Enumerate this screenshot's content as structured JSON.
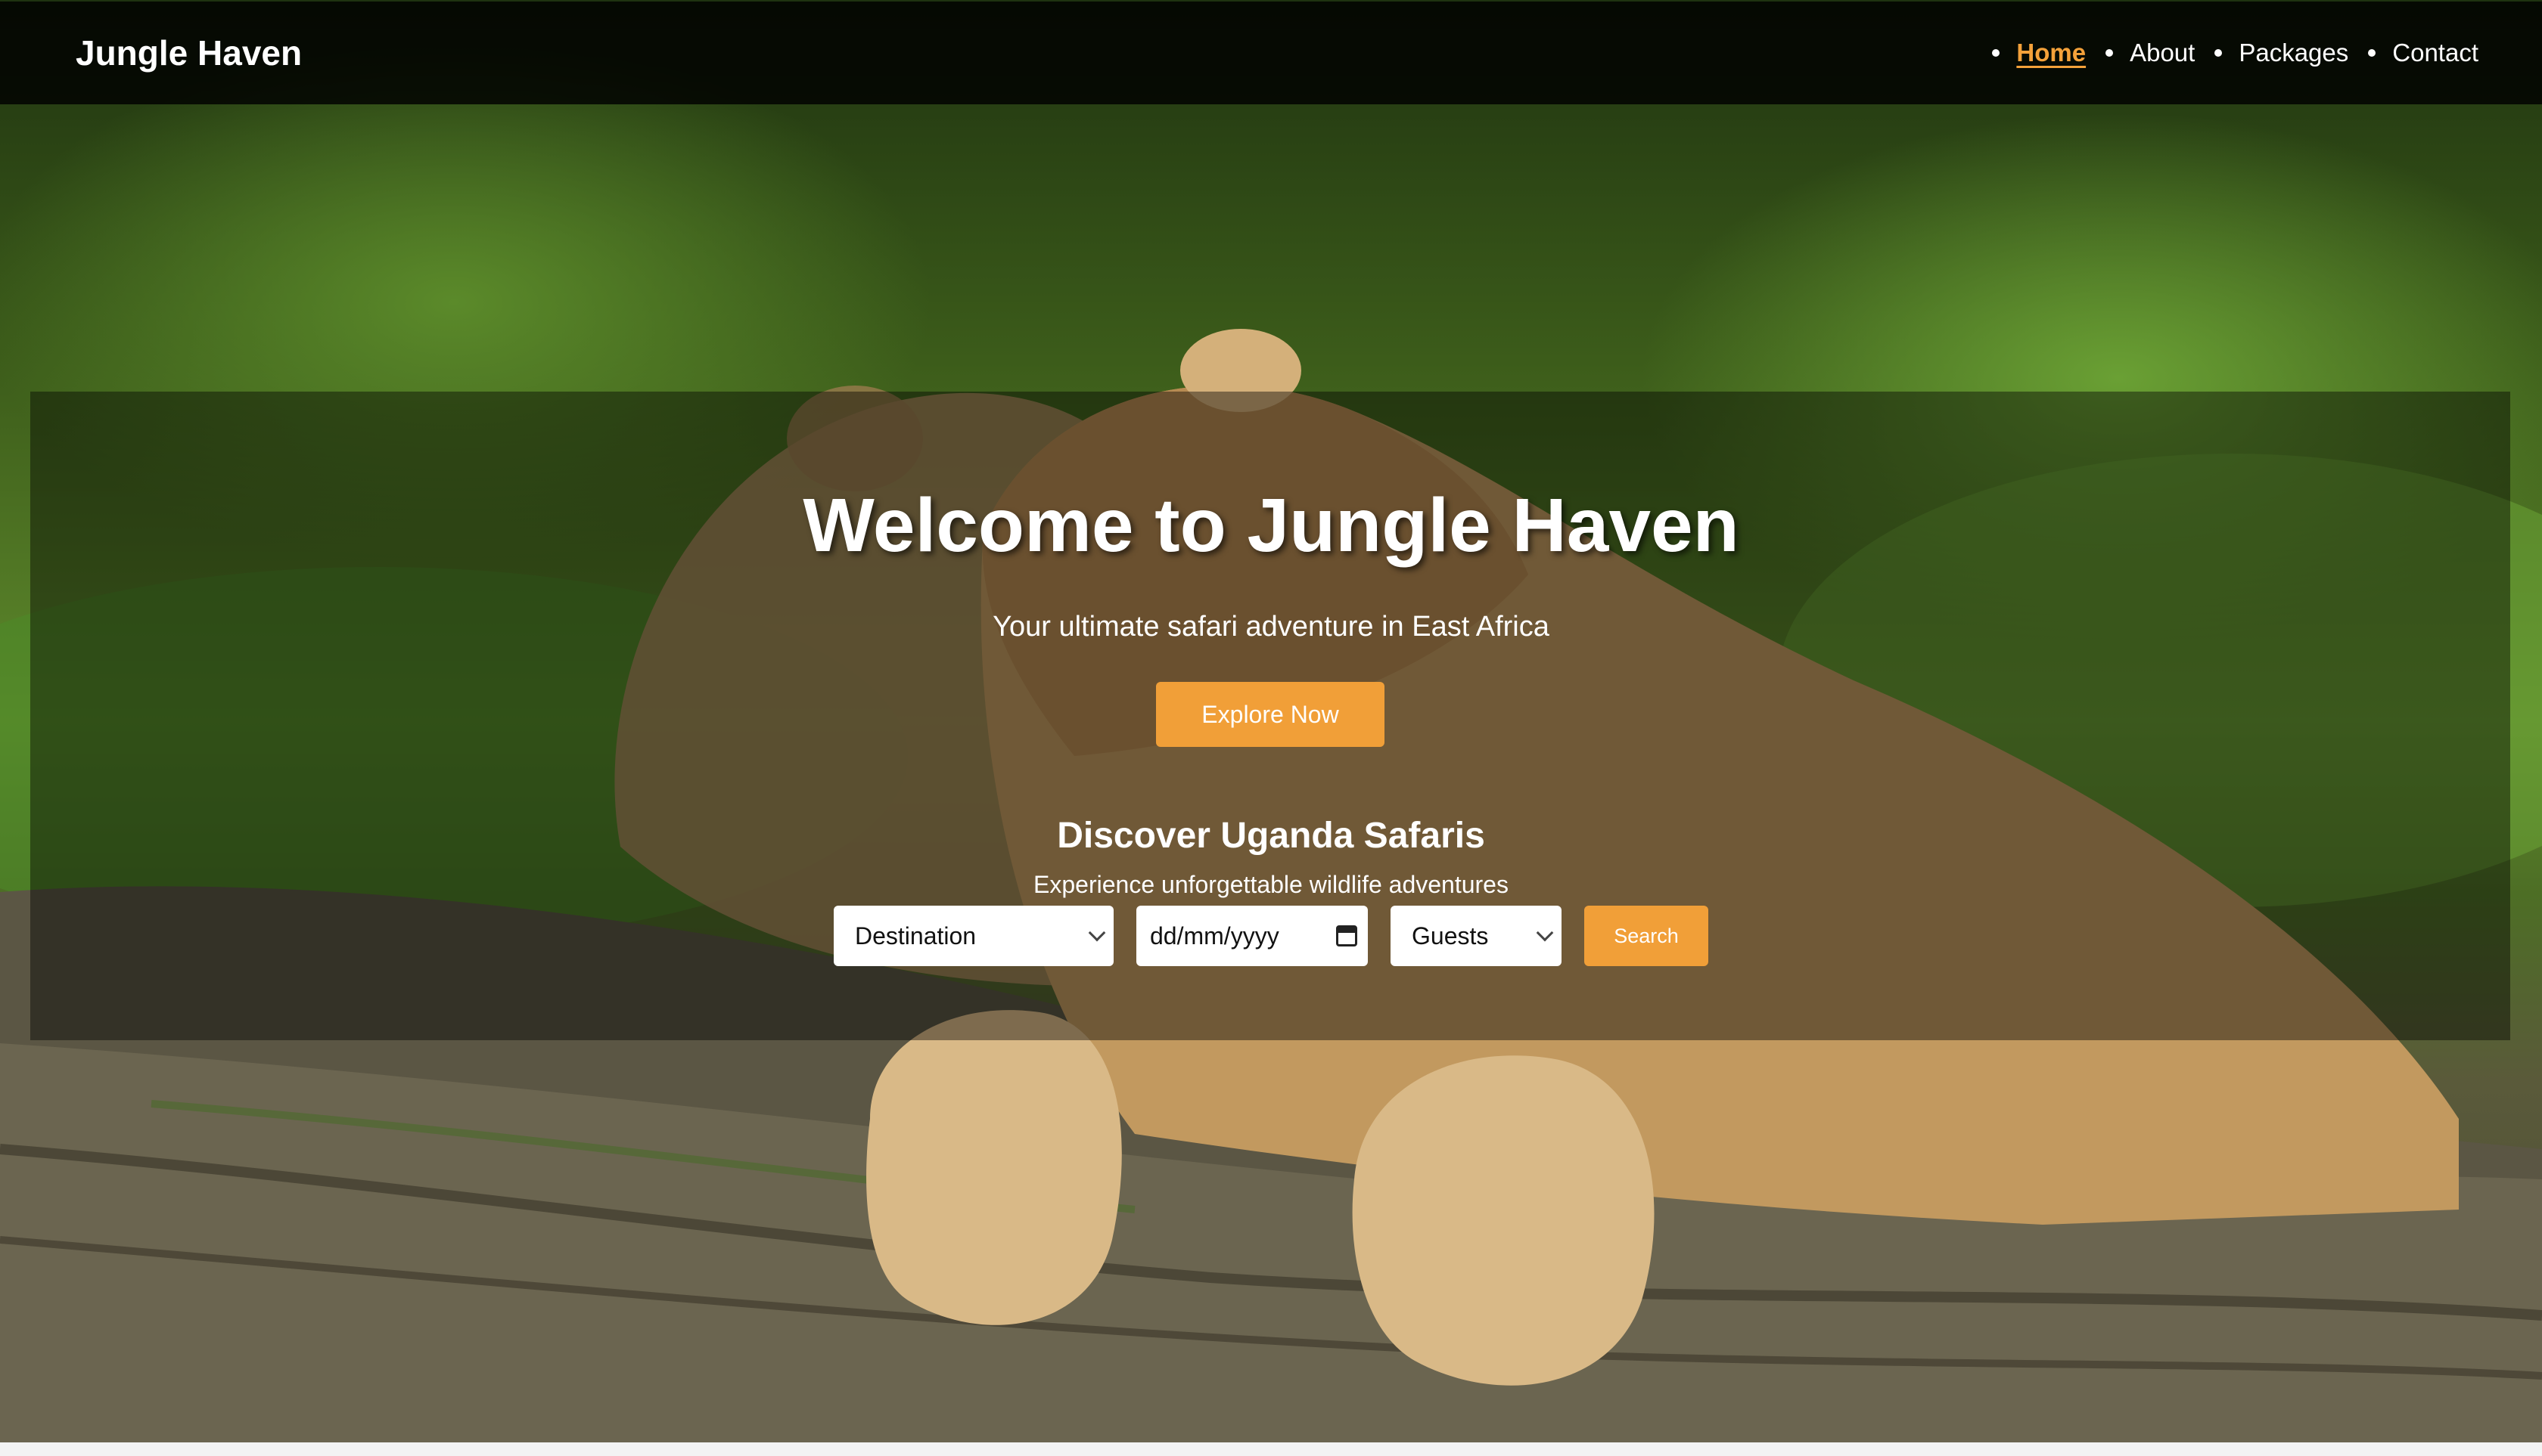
{
  "navbar": {
    "brand": "Jungle Haven",
    "links": [
      {
        "label": "Home",
        "active": true
      },
      {
        "label": "About",
        "active": false
      },
      {
        "label": "Packages",
        "active": false
      },
      {
        "label": "Contact",
        "active": false
      }
    ]
  },
  "hero": {
    "title": "Welcome to Jungle Haven",
    "subtitle": "Your ultimate safari adventure in East Africa",
    "cta_label": "Explore Now",
    "background": "lion-cubs-photo"
  },
  "search": {
    "title": "Discover Uganda Safaris",
    "subtitle": "Experience unforgettable wildlife adventures",
    "destination_value": "Destination",
    "date_placeholder": "dd/mm/yyyy",
    "guests_value": "Guests",
    "button_label": "Search"
  },
  "colors": {
    "accent": "#f19f38",
    "active_link": "#f4a13a",
    "navbar_bg": "#000000"
  }
}
